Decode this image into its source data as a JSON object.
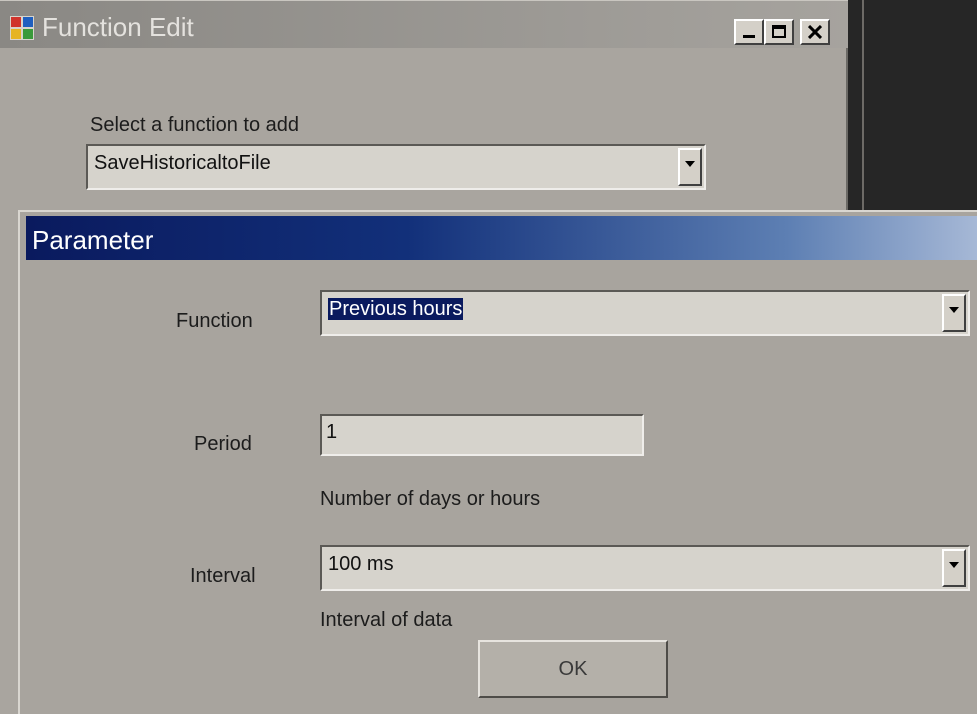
{
  "function_edit": {
    "title": "Function Edit",
    "select_label": "Select a function to add",
    "selected_function": "SaveHistoricaltoFile"
  },
  "parameter": {
    "title": "Parameter",
    "function_label": "Function",
    "function_value": "Previous hours",
    "period_label": "Period",
    "period_value": "1",
    "period_hint": "Number of days or hours",
    "interval_label": "Interval",
    "interval_value": "100 ms",
    "interval_hint": "Interval of data",
    "ok_label": "OK"
  },
  "icons": {
    "app_icon": "app-window-icon",
    "minimize": "minimize-icon",
    "maximize": "maximize-icon",
    "close": "close-icon",
    "dropdown": "chevron-down-icon"
  },
  "colors": {
    "dialog_bg": "#a8a49e",
    "title_active_start": "#0a1a5e",
    "title_active_end": "#a6b8d6",
    "selection_bg": "#0a1a5e"
  }
}
